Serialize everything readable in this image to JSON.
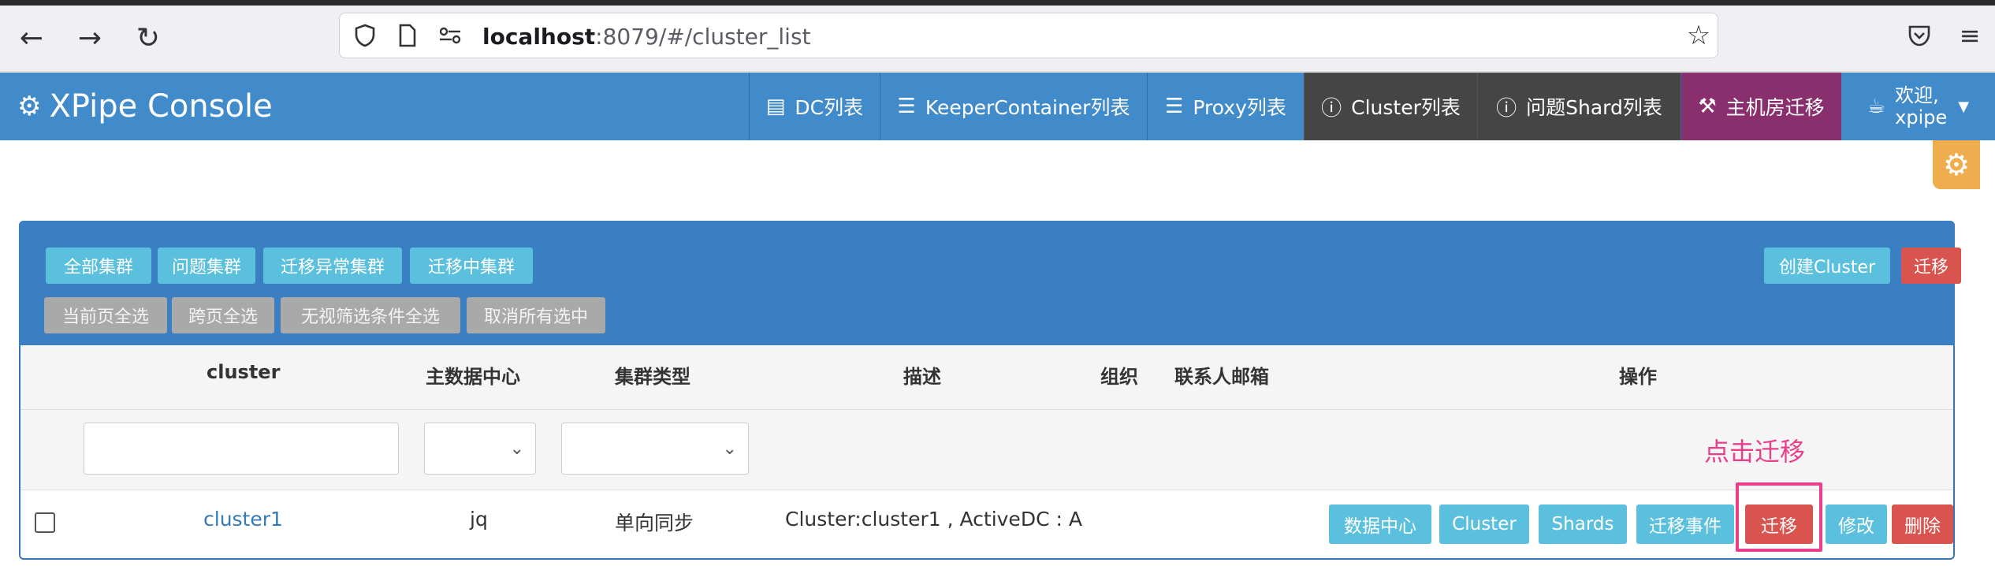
{
  "browser": {
    "url_host": "localhost",
    "url_rest": ":8079/#/cluster_list",
    "icons": [
      "back-arrow-icon",
      "forward-arrow-icon",
      "reload-icon",
      "shield-icon",
      "page-icon",
      "permissions-icon",
      "bookmark-star-icon",
      "pocket-icon",
      "menu-icon"
    ]
  },
  "navbar": {
    "brand": "XPipe Console",
    "items": [
      {
        "label": "DC列表",
        "icon": "table-icon"
      },
      {
        "label": "KeeperContainer列表",
        "icon": "list-icon"
      },
      {
        "label": "Proxy列表",
        "icon": "list-icon"
      },
      {
        "label": "Cluster列表",
        "icon": "info-icon"
      },
      {
        "label": "问题Shard列表",
        "icon": "info-icon"
      },
      {
        "label": "主机房迁移",
        "icon": "gavel-icon"
      }
    ],
    "welcome_line1": "欢迎,",
    "welcome_line2": "xpipe"
  },
  "panel": {
    "filter_buttons": [
      "全部集群",
      "问题集群",
      "迁移异常集群",
      "迁移中集群"
    ],
    "select_buttons": [
      "当前页全选",
      "跨页全选",
      "无视筛选条件全选",
      "取消所有选中"
    ],
    "create_button": "创建Cluster",
    "migrate_button": "迁移"
  },
  "table": {
    "headers": [
      "cluster",
      "主数据中心",
      "集群类型",
      "描述",
      "组织",
      "联系人邮箱",
      "操作"
    ],
    "annotation": "点击迁移",
    "rows": [
      {
        "cluster": "cluster1",
        "dc": "jq",
        "type": "单向同步",
        "desc": "Cluster:cluster1 , ActiveDC : A",
        "actions": [
          "数据中心",
          "Cluster",
          "Shards",
          "迁移事件",
          "迁移",
          "修改",
          "删除"
        ]
      }
    ]
  },
  "colors": {
    "navbar": "#428bca",
    "panel_heading": "#3a7fc1",
    "info_button": "#5bc0de",
    "danger_button": "#d9534f",
    "annotation": "#e83e8c"
  }
}
